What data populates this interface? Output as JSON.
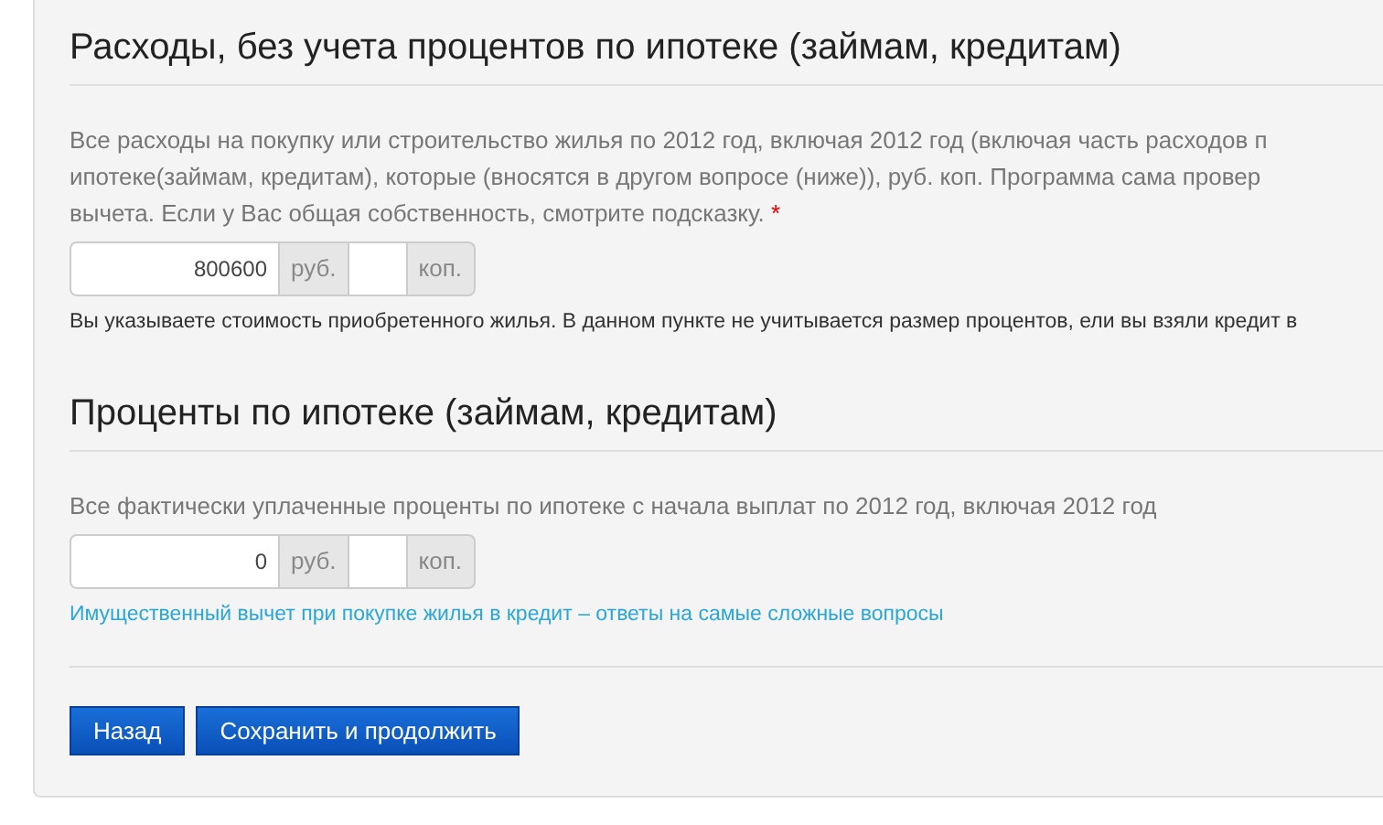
{
  "sections": [
    {
      "title": "Расходы, без учета процентов по ипотеке (займам, кредитам)",
      "description": [
        "Все расходы на покупку или строительство жилья по 2012 год, включая 2012 год (включая часть расходов п",
        "ипотеке(займам, кредитам), которые (вносятся в другом вопросе (ниже)), руб. коп. Программа сама провер",
        "вычета. Если у Вас общая собственность, смотрите подсказку."
      ],
      "required": true,
      "rub_value": "800600",
      "rub_unit": "руб.",
      "kop_unit": "коп.",
      "help": {
        "kind": "note",
        "text": "Вы указываете стоимость приобретенного жилья. В данном пункте не учитывается размер процентов, ели вы взяли кредит в"
      }
    },
    {
      "title": "Проценты по ипотеке (займам, кредитам)",
      "description": [
        "Все фактически уплаченные проценты по ипотеке с начала выплат по 2012 год, включая 2012 год"
      ],
      "required": false,
      "rub_value": "0",
      "rub_unit": "руб.",
      "kop_unit": "коп.",
      "help": {
        "kind": "link",
        "text": "Имущественный вычет при покупке жилья в кредит – ответы на самые сложные вопросы"
      }
    }
  ],
  "required_mark": "*",
  "buttons": [
    "Назад",
    "Сохранить и продолжить"
  ]
}
